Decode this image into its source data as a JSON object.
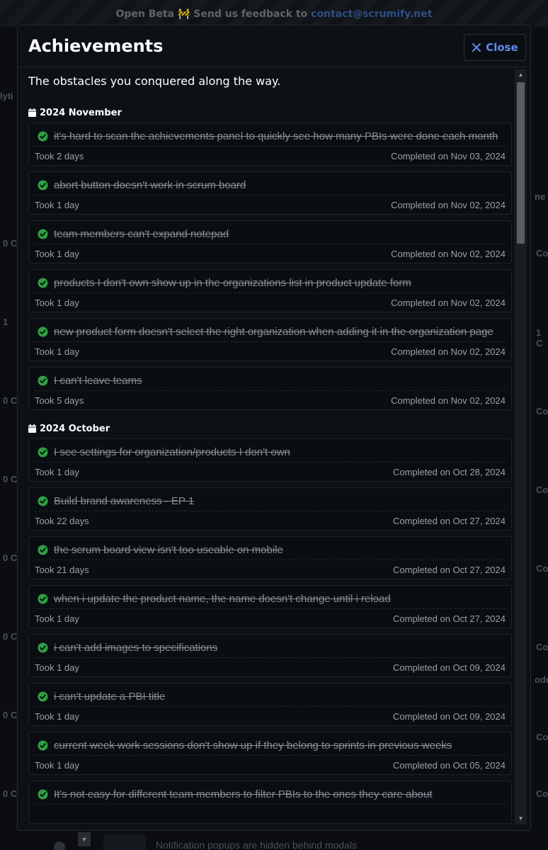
{
  "banner": {
    "text": "Open Beta 🚧 Send us feedback to",
    "email": "contact@scrumify.net"
  },
  "background": {
    "left_fragments": [
      "lyti",
      "0 C",
      "1",
      "0 C",
      "0 C",
      "0 C",
      "0 C",
      "0 C",
      "0 C",
      "0 C"
    ],
    "right_fragments": [
      "ne",
      "Co",
      "1 C",
      "Co",
      "Co",
      "Co",
      "Co",
      "odu",
      "Co",
      "Co"
    ],
    "bottom_text": "Notification popups are hidden behind modals"
  },
  "modal": {
    "title": "Achievements",
    "close_label": "Close",
    "subtitle": "The obstacles you conquered along the way.",
    "colors": {
      "accent": "#5b8def",
      "check": "#2ea043"
    }
  },
  "months": [
    {
      "label": "2024 November",
      "items": [
        {
          "title": "it's hard to scan the achievements panel to quickly see how many PBIs were done each month",
          "took": "Took 2 days",
          "completed": "Completed on Nov 03, 2024"
        },
        {
          "title": "abort button doesn't work in scrum board",
          "took": "Took 1 day",
          "completed": "Completed on Nov 02, 2024"
        },
        {
          "title": "team members can't expand notepad",
          "took": "Took 1 day",
          "completed": "Completed on Nov 02, 2024"
        },
        {
          "title": "products I don't own show up in the organizations list in product update form",
          "took": "Took 1 day",
          "completed": "Completed on Nov 02, 2024"
        },
        {
          "title": "new product form doesn't select the right organization when adding it in the organization page",
          "took": "Took 1 day",
          "completed": "Completed on Nov 02, 2024"
        },
        {
          "title": "I can't leave teams",
          "took": "Took 5 days",
          "completed": "Completed on Nov 02, 2024"
        }
      ]
    },
    {
      "label": "2024 October",
      "items": [
        {
          "title": "I see settings for organization/products I don't own",
          "took": "Took 1 day",
          "completed": "Completed on Oct 28, 2024"
        },
        {
          "title": "Build brand awareness - EP 1",
          "took": "Took 22 days",
          "completed": "Completed on Oct 27, 2024"
        },
        {
          "title": "the scrum board view isn't too useable on mobile",
          "took": "Took 21 days",
          "completed": "Completed on Oct 27, 2024"
        },
        {
          "title": "when i update the product name, the name doesn't change until i reload",
          "took": "Took 1 day",
          "completed": "Completed on Oct 27, 2024"
        },
        {
          "title": "i can't add images to specifications",
          "took": "Took 1 day",
          "completed": "Completed on Oct 09, 2024"
        },
        {
          "title": "i can't update a PBI title",
          "took": "Took 1 day",
          "completed": "Completed on Oct 09, 2024"
        },
        {
          "title": "current week work sessions don't show up if they belong to sprints in previous weeks",
          "took": "Took 1 day",
          "completed": "Completed on Oct 05, 2024"
        },
        {
          "title": "It's not easy for different team members to filter PBIs to the ones they care about",
          "took": "",
          "completed": ""
        }
      ]
    }
  ]
}
